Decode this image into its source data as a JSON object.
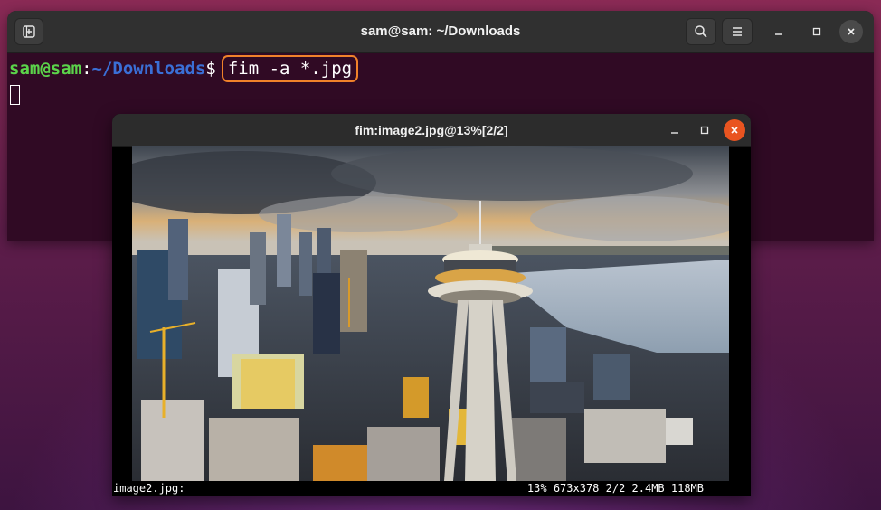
{
  "terminal": {
    "title": "sam@sam: ~/Downloads",
    "prompt_user": "sam@sam",
    "prompt_colon": ":",
    "prompt_path": "~/Downloads",
    "prompt_symbol": "$",
    "command": "fim -a *.jpg",
    "icons": {
      "new_tab": "new-tab-icon",
      "search": "search-icon",
      "menu": "hamburger-menu-icon",
      "minimize": "minimize-icon",
      "maximize": "maximize-icon",
      "close": "close-icon"
    },
    "highlight_color": "#f0822a"
  },
  "viewer": {
    "title": "fim:image2.jpg@13%[2/2]",
    "image_description_icon": "photo-seattle-space-needle",
    "status_left": "image2.jpg:",
    "status_right": "13% 673x378 2/2 2.4MB 118MB",
    "close_color": "#e95420"
  }
}
